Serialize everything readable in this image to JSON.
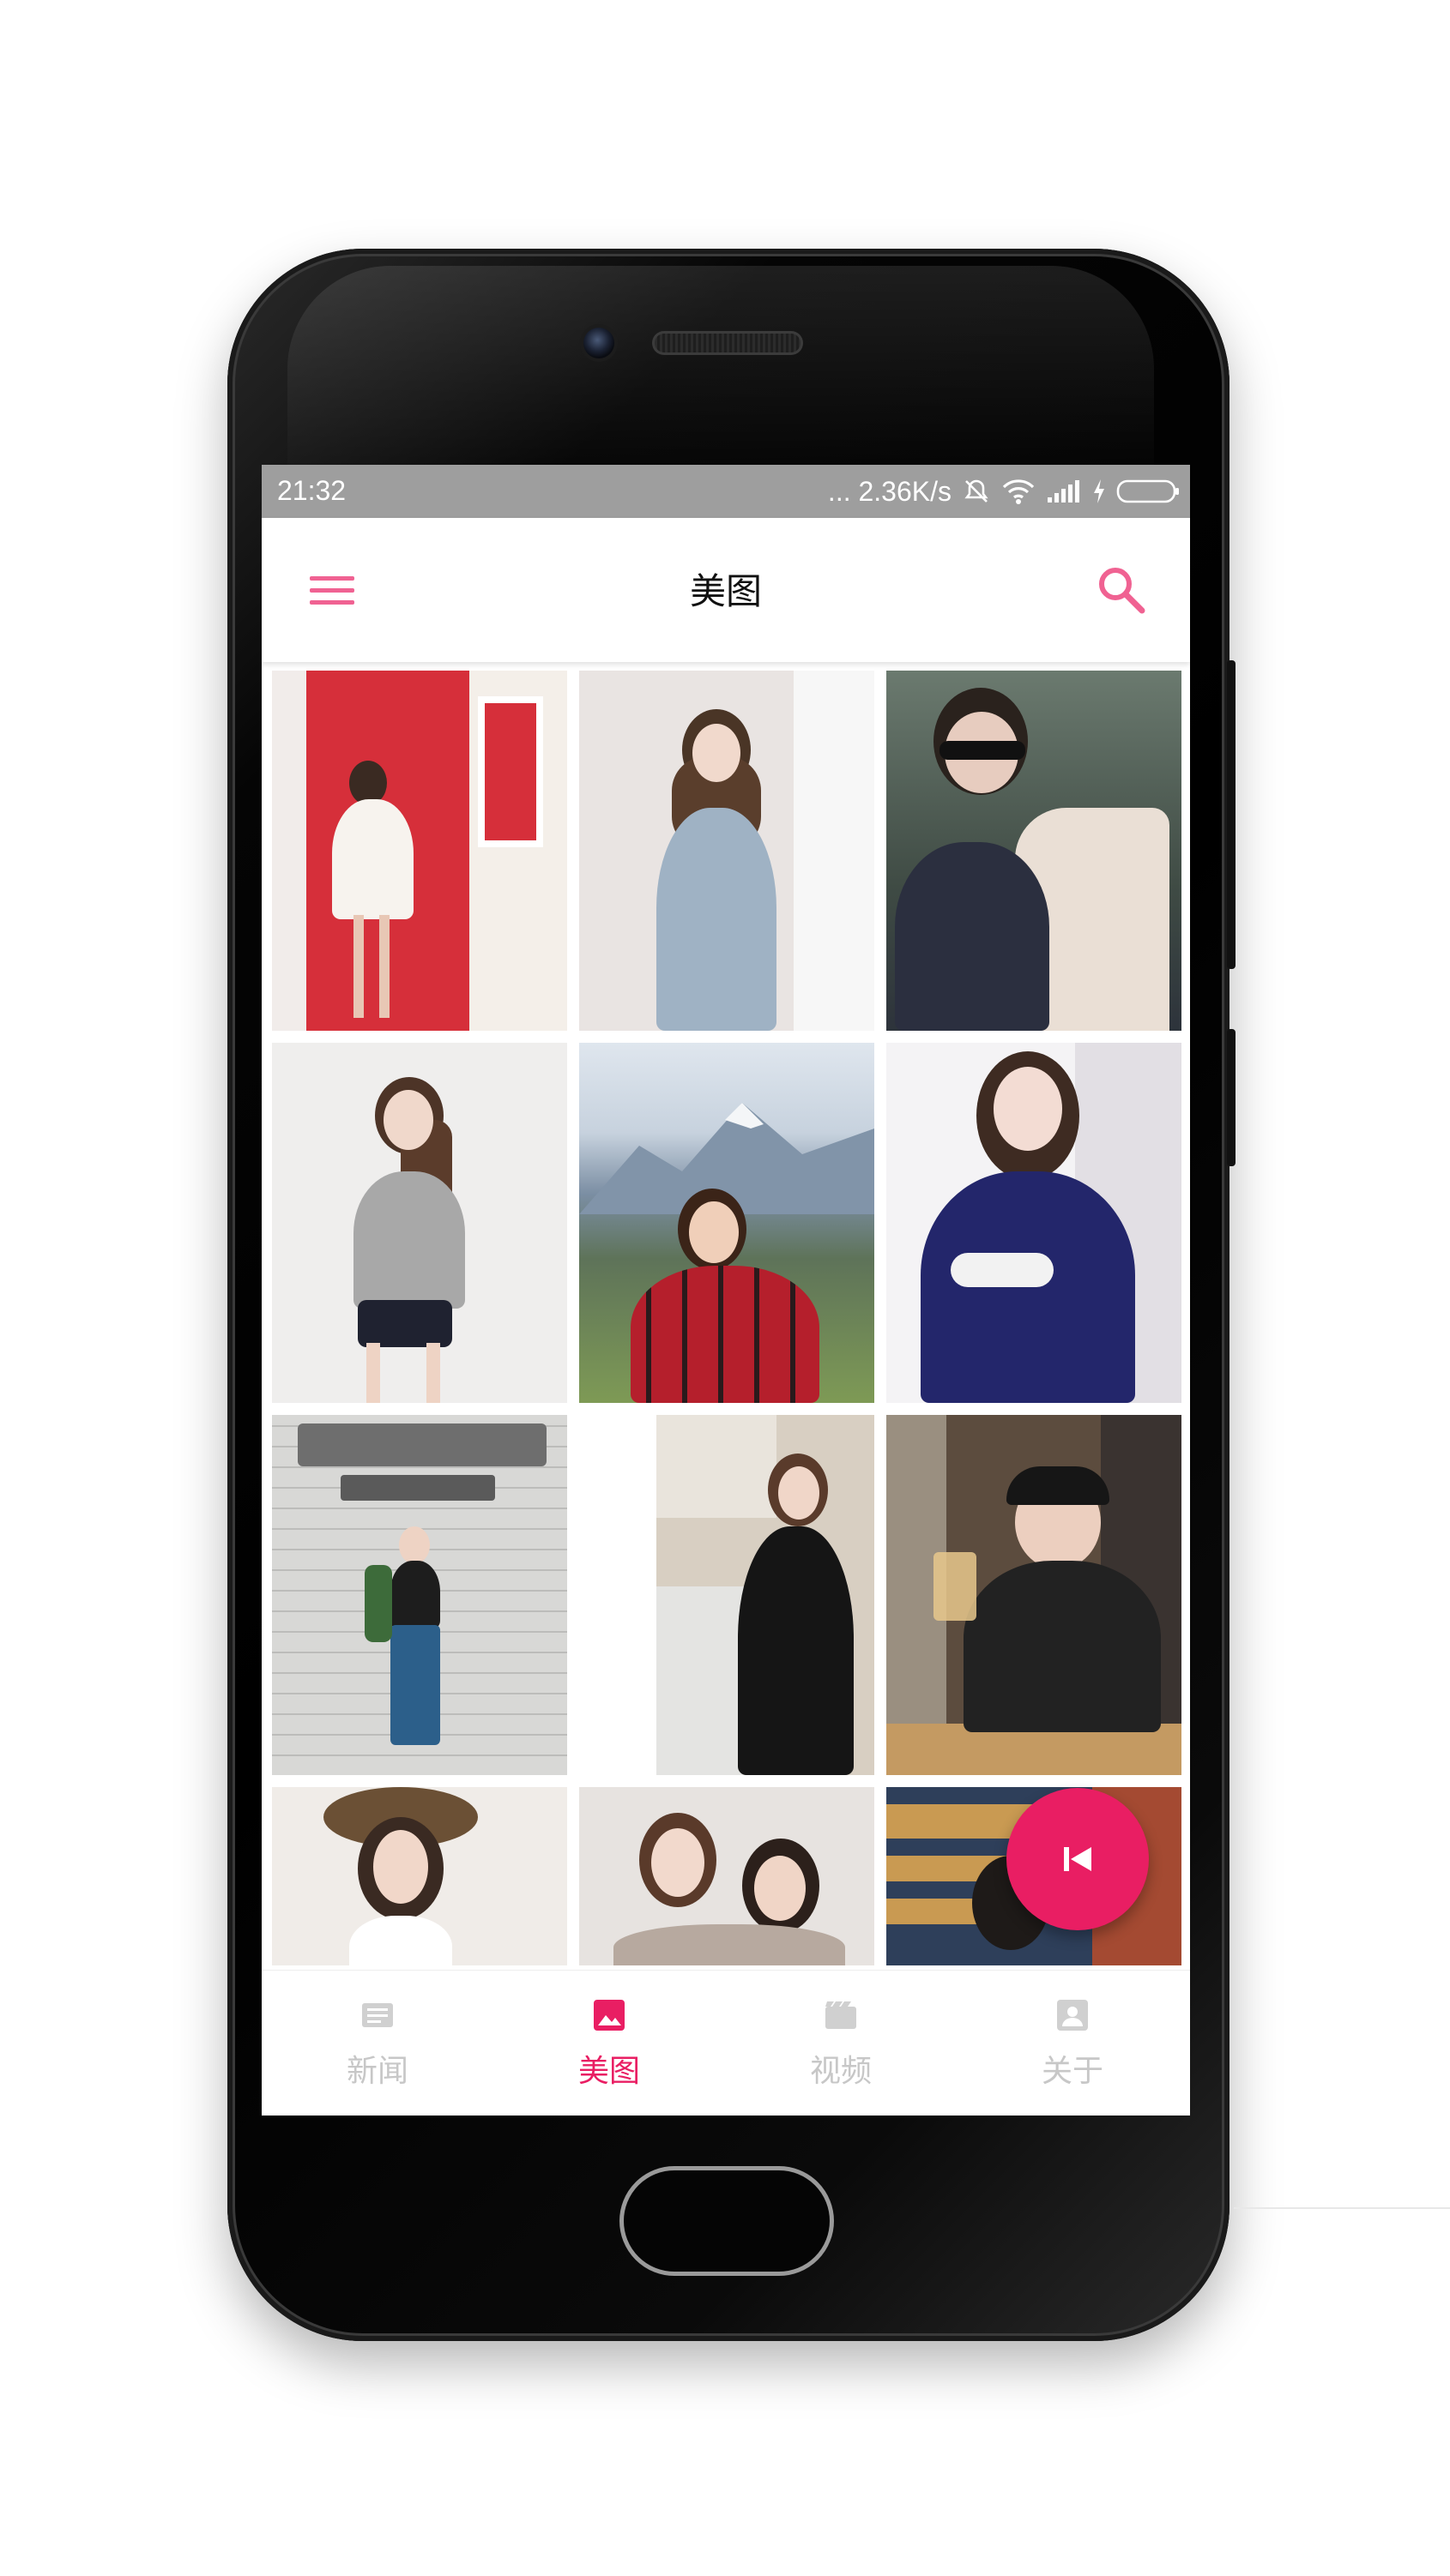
{
  "status_bar": {
    "time": "21:32",
    "speed": "... 2.36K/s"
  },
  "app_bar": {
    "title": "美图",
    "menu_icon": "hamburger-menu-icon",
    "search_icon": "search-icon"
  },
  "colors": {
    "accent": "#e91e63",
    "icon_pink": "#f06292",
    "nav_inactive": "#c7c7c7",
    "status_bar": "#9e9e9e"
  },
  "gallery": {
    "photos": [
      {
        "name": "photo-1",
        "bg": "#d9323e",
        "accent": "#ffffff"
      },
      {
        "name": "photo-2",
        "bg": "#e8e4e2",
        "accent": "#8fa3b5"
      },
      {
        "name": "photo-3",
        "bg": "#4f5f52",
        "accent": "#2a2f3c"
      },
      {
        "name": "photo-4",
        "bg": "#ecebea",
        "accent": "#9c9c9c"
      },
      {
        "name": "photo-5",
        "bg": "#8ea3b8",
        "accent": "#b51f2c"
      },
      {
        "name": "photo-6",
        "bg": "#e9e6ea",
        "accent": "#24286b"
      },
      {
        "name": "photo-7",
        "bg": "#cfcfcd",
        "accent": "#2c5f8a"
      },
      {
        "name": "photo-8",
        "bg": "#d8cfc2",
        "accent": "#1a1a1a"
      },
      {
        "name": "photo-9",
        "bg": "#6a5a4a",
        "accent": "#2a2a2a"
      },
      {
        "name": "photo-10",
        "bg": "#efeae6",
        "accent": "#6b5035"
      },
      {
        "name": "photo-11",
        "bg": "#e6e2df",
        "accent": "#3a2a22"
      },
      {
        "name": "photo-12",
        "bg": "#b8844a",
        "accent": "#2b3b55"
      }
    ]
  },
  "fab": {
    "icon": "skip-previous-icon"
  },
  "bottom_nav": {
    "items": [
      {
        "label": "新闻",
        "icon": "news-icon",
        "active": false
      },
      {
        "label": "美图",
        "icon": "image-icon",
        "active": true
      },
      {
        "label": "视频",
        "icon": "video-icon",
        "active": false
      },
      {
        "label": "关于",
        "icon": "profile-icon",
        "active": false
      }
    ]
  }
}
